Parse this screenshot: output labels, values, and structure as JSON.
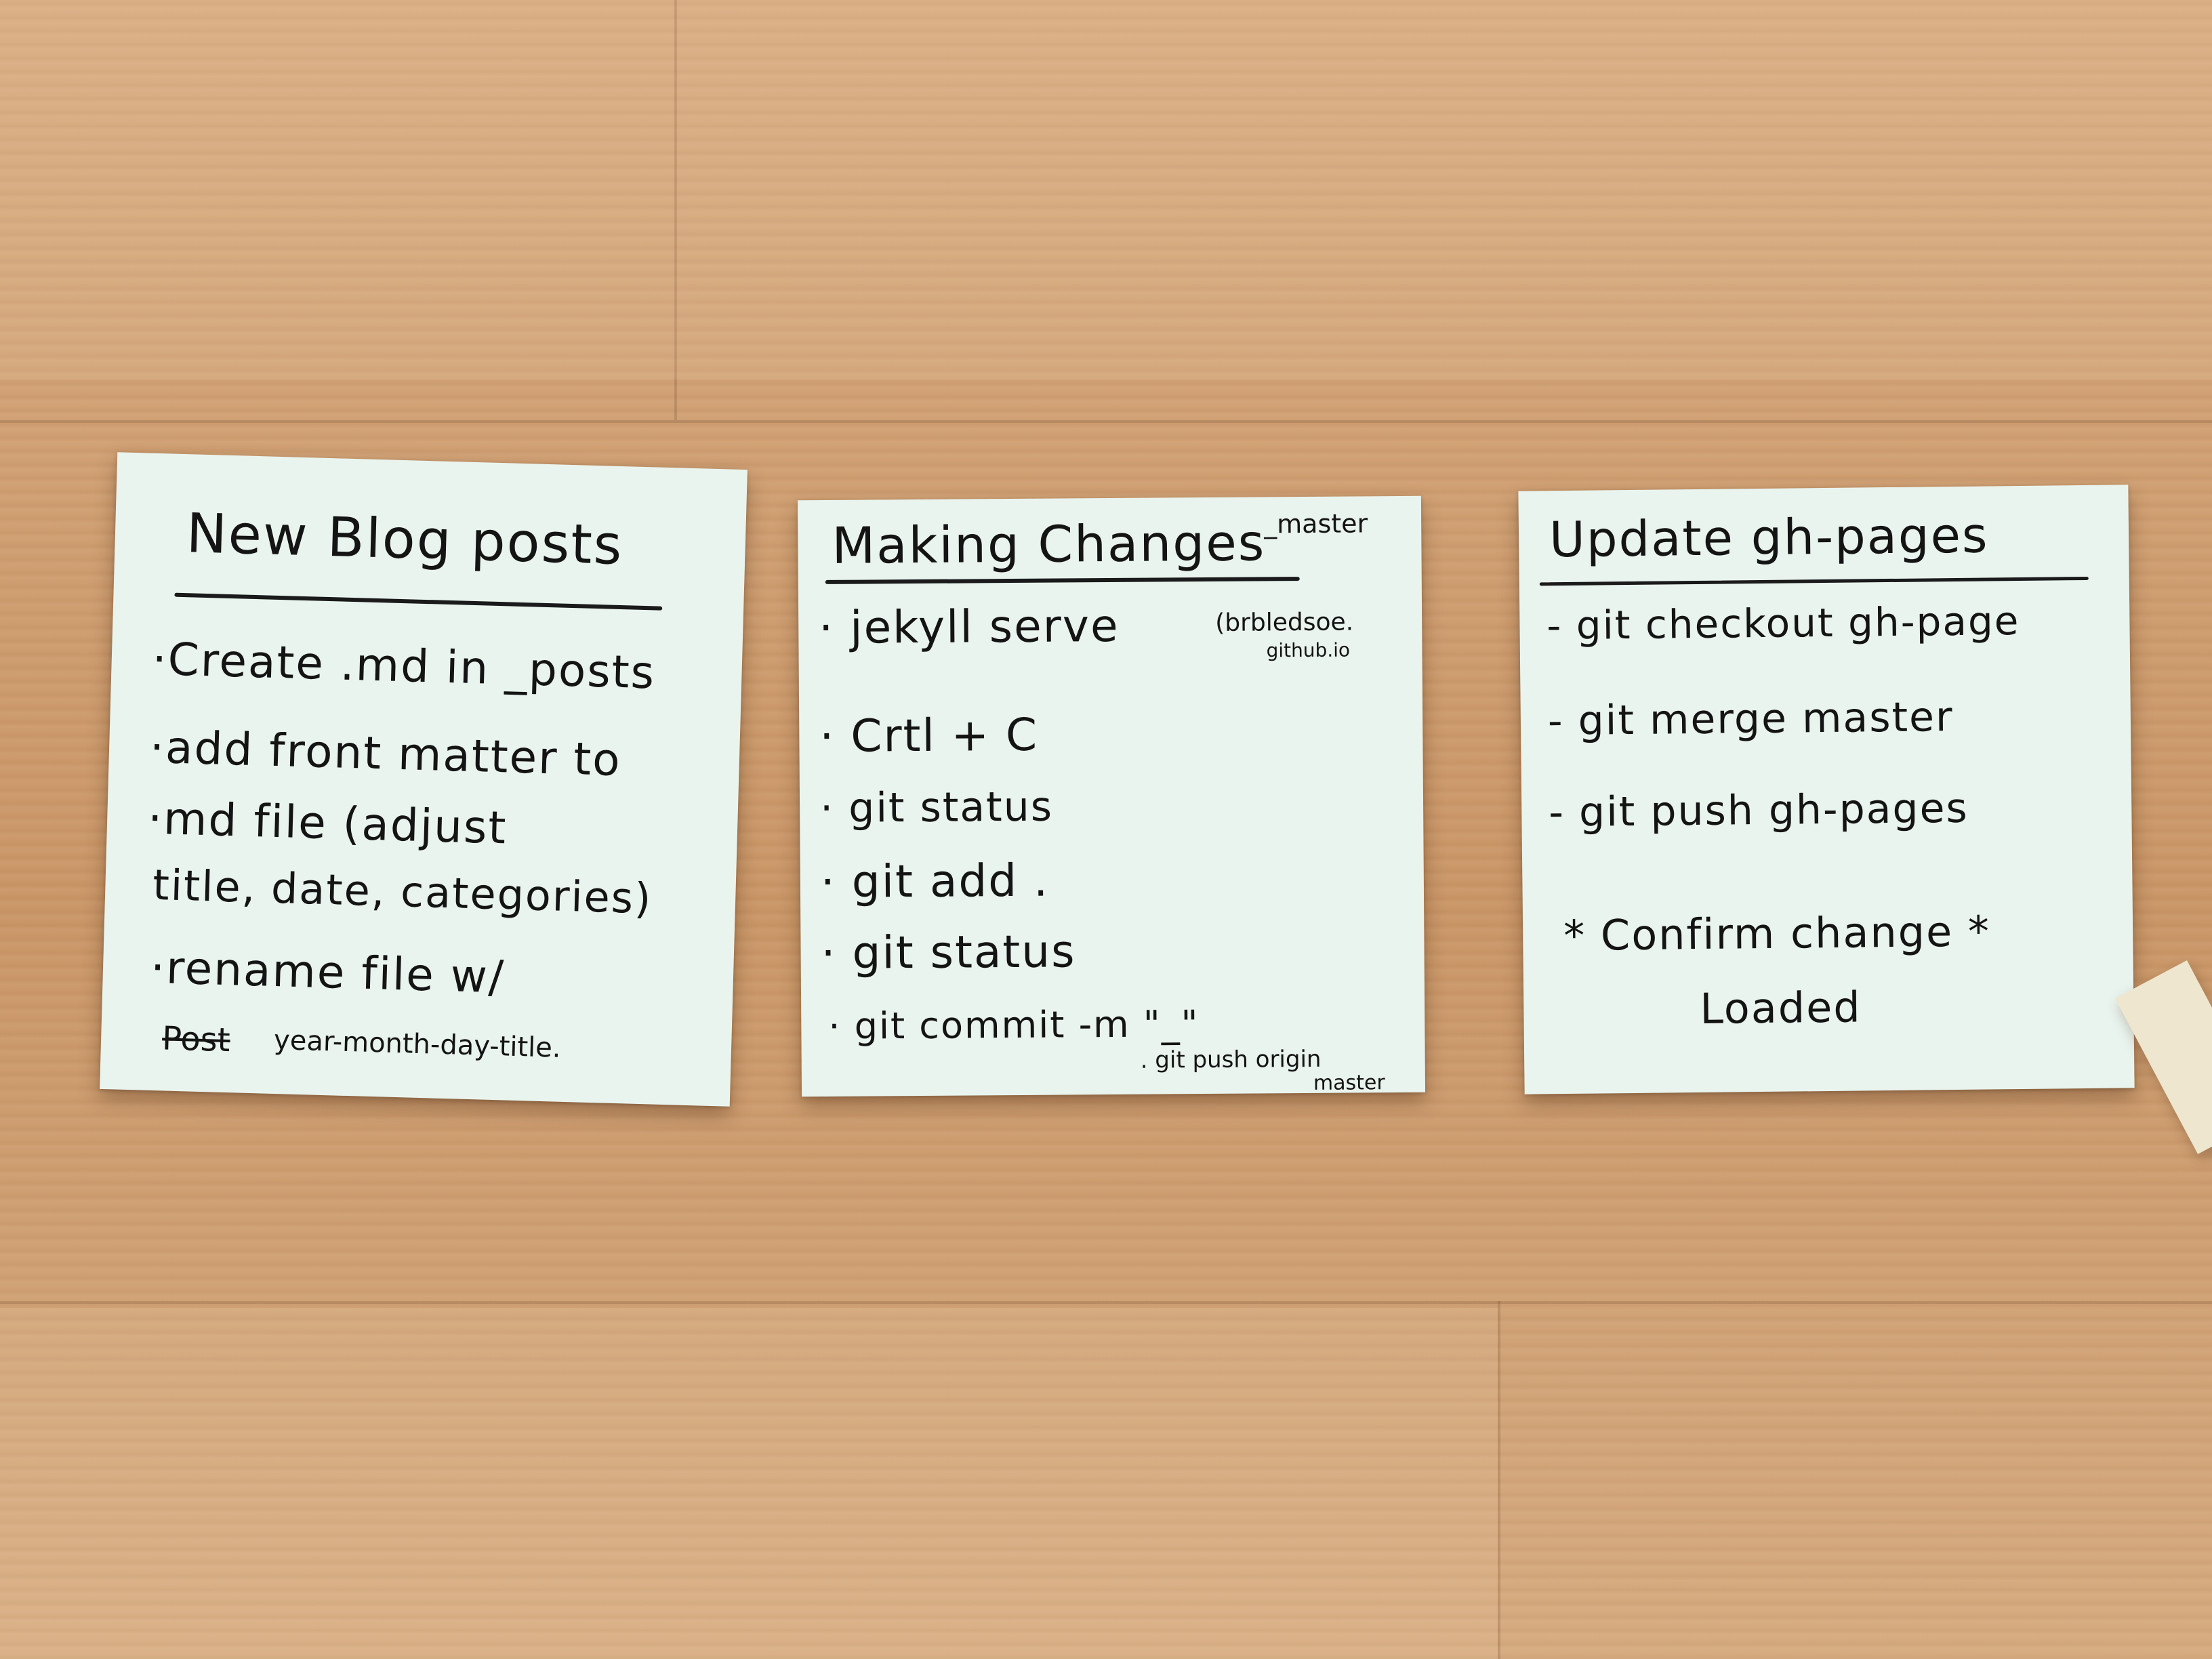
{
  "notes": [
    {
      "title": "New Blog posts",
      "lines": [
        "·Create .md in _posts",
        "·add front matter to",
        "·md file (adjust",
        "title, date, categories)",
        "·rename file w/",
        "year-month-day-title."
      ],
      "scribble": "Post"
    },
    {
      "title": "Making Changes",
      "title_note": "_master",
      "lines": [
        "· jekyll serve",
        "· Crtl + C",
        "· git status",
        "· git add .",
        "· git status",
        "· git commit -m \"_\""
      ],
      "side_note": "(brbledsoe.",
      "side_note2": "github.io",
      "push_note": ". git push origin",
      "push_note2": "master"
    },
    {
      "title": "Update gh-pages",
      "lines": [
        "- git checkout gh-page",
        "- git merge master",
        "- git push gh-pages"
      ],
      "footer": "* Confirm change *",
      "footer2": "Loaded"
    }
  ],
  "colors": {
    "desk": "#cf9d6f",
    "note": "#eaf4ee",
    "ink": "#141414"
  }
}
